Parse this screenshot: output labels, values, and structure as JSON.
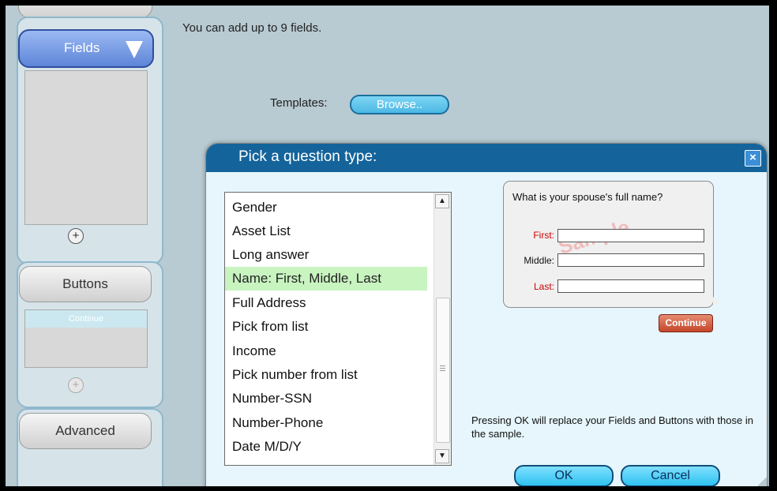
{
  "sidebar": {
    "fields_label": "Fields",
    "buttons_label": "Buttons",
    "advanced_label": "Advanced",
    "continue_preview": "Continue",
    "plus": "+"
  },
  "main": {
    "info_text": "You can add up to 9 fields.",
    "templates_label": "Templates:",
    "browse_label": "Browse.."
  },
  "dialog": {
    "title": "Pick a question type:",
    "close_label": "×",
    "list_items": [
      "Gender",
      "Asset List",
      "Long answer",
      "Name: First, Middle, Last",
      "Full Address",
      "Pick from list",
      "Income",
      "Pick number from list",
      "Number-SSN",
      "Number-Phone",
      "Date M/D/Y"
    ],
    "selected_index": 3,
    "sample": {
      "question": "What is your spouse's full name?",
      "first_label": "First:",
      "middle_label": "Middle:",
      "last_label": "Last:",
      "watermark": "Sample",
      "continue_label": "Continue"
    },
    "note": "Pressing OK will  replace your Fields and Buttons with those in the sample.",
    "ok_label": "OK",
    "cancel_label": "Cancel"
  },
  "colors": {
    "header": "#14649b",
    "selected_row": "#c8f4c0",
    "required_label": "#cc0000"
  }
}
